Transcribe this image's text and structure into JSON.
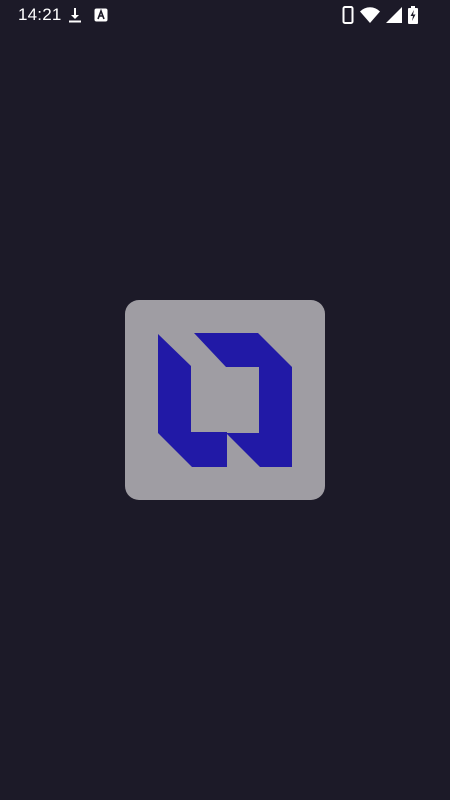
{
  "status_bar": {
    "time": "14:21",
    "left_icons": [
      "download-icon",
      "app-notification-icon"
    ],
    "right_icons": [
      "phone-icon",
      "wifi-icon",
      "cell-signal-icon",
      "battery-charging-icon"
    ]
  },
  "splash": {
    "logo_icon": "app-logo-icon",
    "logo_color": "#2119a6",
    "tile_color": "#9f9da3",
    "background_color": "#1c1a28"
  }
}
